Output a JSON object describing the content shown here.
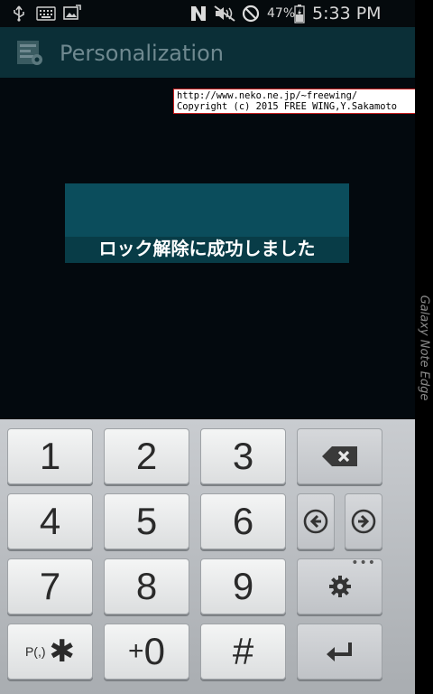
{
  "status_bar": {
    "battery_percent": "47%",
    "time": "5:33 PM",
    "icons": [
      "usb-icon",
      "keyboard-icon",
      "gallery-icon",
      "nfc-icon",
      "mute-icon",
      "block-icon",
      "battery-icon"
    ]
  },
  "app_bar": {
    "title": "Personalization",
    "icon": "app-settings-icon"
  },
  "overlay": {
    "line1": "http://www.neko.ne.jp/~freewing/",
    "line2": "Copyright (c) 2015 FREE WING,Y.Sakamoto"
  },
  "dialog": {
    "message": "ロック解除に成功しました"
  },
  "edge": {
    "label": "Galaxy Note Edge"
  },
  "keypad": {
    "k1": "1",
    "k2": "2",
    "k3": "3",
    "k4": "4",
    "k5": "5",
    "k6": "6",
    "k7": "7",
    "k8": "8",
    "k9": "9",
    "k_p_small": "P(,)",
    "k_p_big": "✱",
    "k_zero_small": "+",
    "k_zero_big": "0",
    "k_hash": "#",
    "settings_dots": "•••",
    "function_icons": [
      "backspace-icon",
      "arrow-left-icon",
      "arrow-right-icon",
      "gear-icon",
      "enter-icon"
    ]
  },
  "colors": {
    "action_bar": "#0b2f37",
    "dialog": "#0b4d5c",
    "background": "#03090e"
  }
}
